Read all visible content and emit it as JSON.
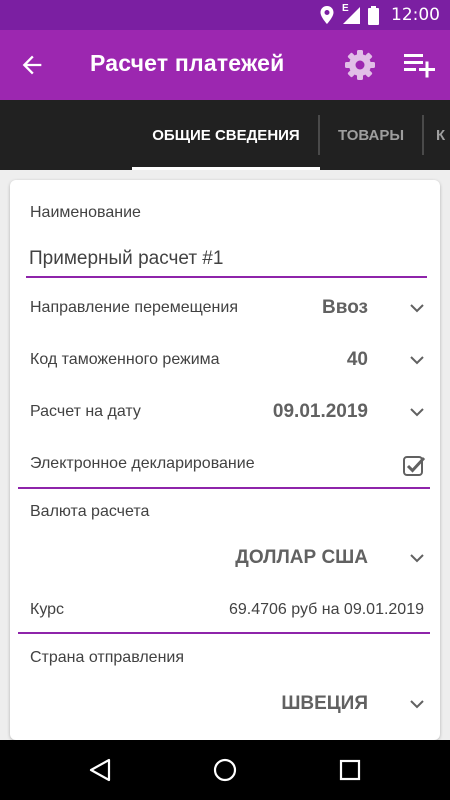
{
  "status_bar": {
    "network_type": "E",
    "time": "12:00",
    "icons": [
      "location-icon",
      "signal-icon",
      "battery-icon"
    ]
  },
  "app_bar": {
    "title": "Расчет платежей",
    "icons": [
      "arrow-back-icon",
      "settings-icon",
      "playlist-add-icon"
    ]
  },
  "tabs": [
    {
      "label": "ОБЩИЕ СВЕДЕНИЯ",
      "active": true
    },
    {
      "label": "ТОВАРЫ",
      "active": false
    },
    {
      "label": "К",
      "active": false
    }
  ],
  "form": {
    "name_label": "Наименование",
    "name_value": "Примерный расчет #1",
    "direction": {
      "label": "Направление перемещения",
      "value": "Ввоз"
    },
    "customs_code": {
      "label": "Код таможенного режима",
      "value": "40"
    },
    "date": {
      "label": "Расчет на дату",
      "value": "09.01.2019"
    },
    "electronic": {
      "label": "Электронное декларирование",
      "checked": true
    },
    "currency_label": "Валюта расчета",
    "currency_value": "ДОЛЛАР США",
    "rate_label": "Курс",
    "rate_value": "69.4706 руб на 09.01.2019",
    "country_label": "Страна отправления",
    "country_value": "ШВЕЦИЯ"
  },
  "nav_bar": {
    "icons": [
      "back-triangle-icon",
      "home-circle-icon",
      "recents-square-icon"
    ]
  },
  "colors": {
    "status_bar": "#7b1fa2",
    "app_bar": "#9c27b0",
    "tab_bar": "#212121",
    "accent": "#8e24aa"
  }
}
